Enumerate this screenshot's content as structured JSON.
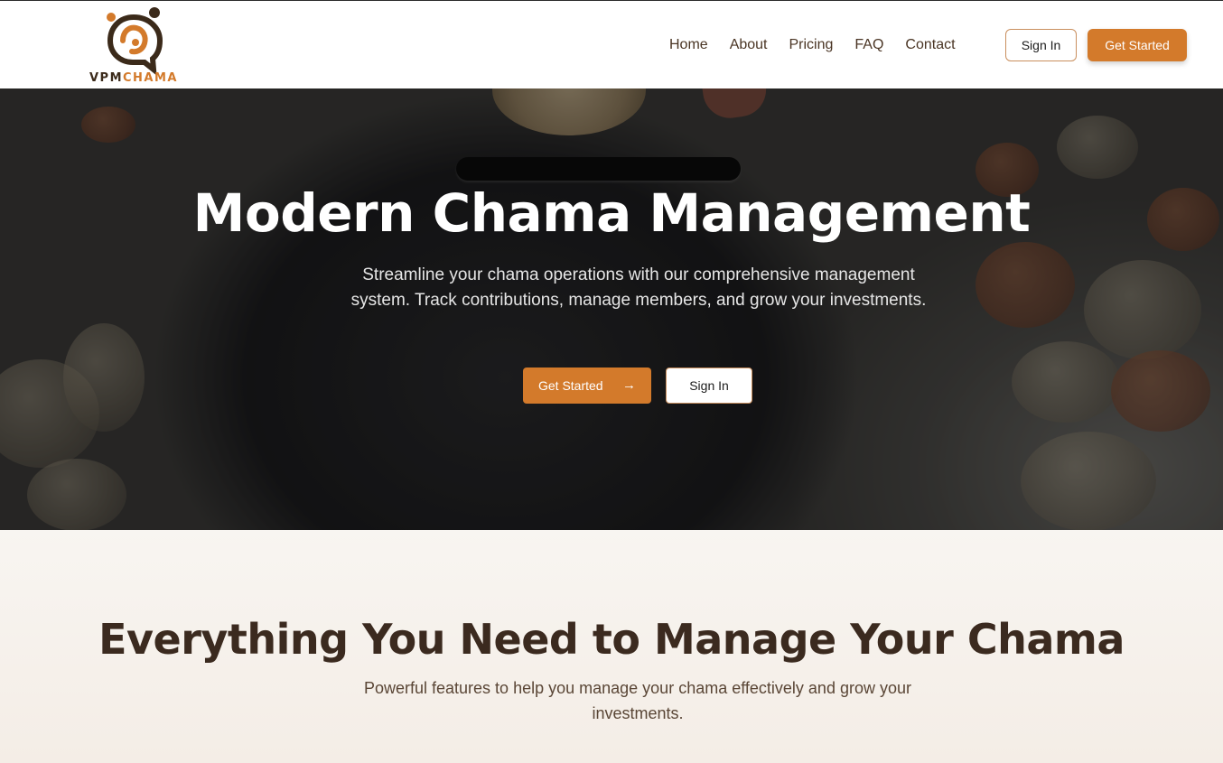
{
  "brand": {
    "name_part1": "VPM",
    "name_part2": "CHAMA",
    "accent_color": "#d37a2b",
    "dark_color": "#3b2a1a"
  },
  "nav": {
    "items": [
      {
        "label": "Home"
      },
      {
        "label": "About"
      },
      {
        "label": "Pricing"
      },
      {
        "label": "FAQ"
      },
      {
        "label": "Contact"
      }
    ],
    "sign_in_label": "Sign In",
    "get_started_label": "Get Started"
  },
  "hero": {
    "title": "Modern Chama Management",
    "subtitle": "Streamline your chama operations with our comprehensive management system. Track contributions, manage members, and grow your investments.",
    "primary_button": "Get Started",
    "primary_button_icon": "arrow-right-icon",
    "secondary_button": "Sign In",
    "background_image": "piggy-bank-with-coins"
  },
  "features": {
    "title": "Everything You Need to Manage Your Chama",
    "subtitle": "Powerful features to help you manage your chama effectively and grow your investments."
  }
}
